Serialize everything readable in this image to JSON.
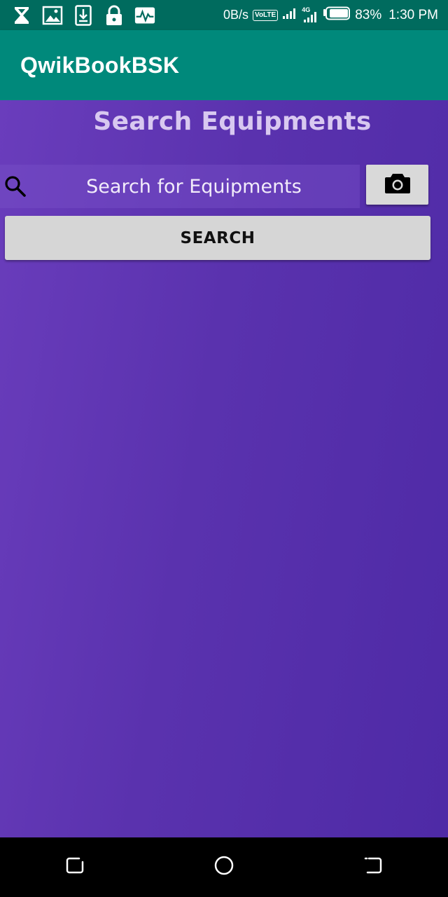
{
  "status_bar": {
    "left_icons": [
      "hourglass-icon",
      "image-icon",
      "download-icon",
      "lock-icon",
      "activity-icon"
    ],
    "net_speed": "0B/s",
    "volte": "VoLTE",
    "network": "4G",
    "battery": "83%",
    "time": "1:30 PM"
  },
  "app_bar": {
    "title": "QwikBookBSK"
  },
  "main": {
    "heading": "Search Equipments",
    "search": {
      "placeholder": "Search for Equipments",
      "value": ""
    },
    "search_button": "SEARCH"
  },
  "nav_bar": {
    "buttons": [
      "recents",
      "home",
      "back"
    ]
  },
  "colors": {
    "status_bar": "#006B5E",
    "app_bar": "#00897B",
    "background_start": "#6A3DBC",
    "background_end": "#4E2AA6",
    "button": "#D6D6D6"
  }
}
